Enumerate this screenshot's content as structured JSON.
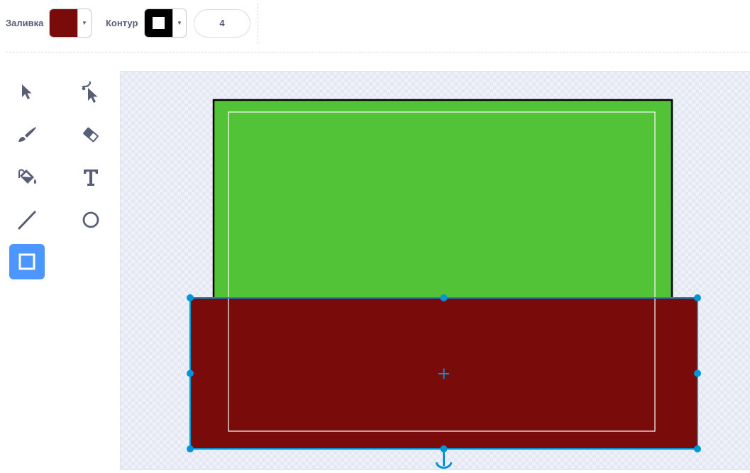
{
  "toolbar": {
    "fill_label": "Заливка",
    "fill_color": "#7a0b0b",
    "outline_label": "Контур",
    "outline_color": "#000000",
    "stroke_width": "4"
  },
  "tools": [
    {
      "name": "select-tool",
      "icon": "arrow-pointer-icon"
    },
    {
      "name": "reshape-tool",
      "icon": "reshape-pointer-icon"
    },
    {
      "name": "brush-tool",
      "icon": "brush-icon"
    },
    {
      "name": "eraser-tool",
      "icon": "eraser-icon"
    },
    {
      "name": "fill-tool",
      "icon": "paint-bucket-icon"
    },
    {
      "name": "text-tool",
      "icon": "text-icon"
    },
    {
      "name": "line-tool",
      "icon": "line-icon"
    },
    {
      "name": "circle-tool",
      "icon": "circle-icon"
    },
    {
      "name": "rectangle-tool",
      "icon": "rectangle-icon",
      "active": true
    }
  ],
  "canvas": {
    "green_rect_color": "#52c236",
    "red_rect_color": "#7a0b0b",
    "selection_color": "#0094d9"
  }
}
